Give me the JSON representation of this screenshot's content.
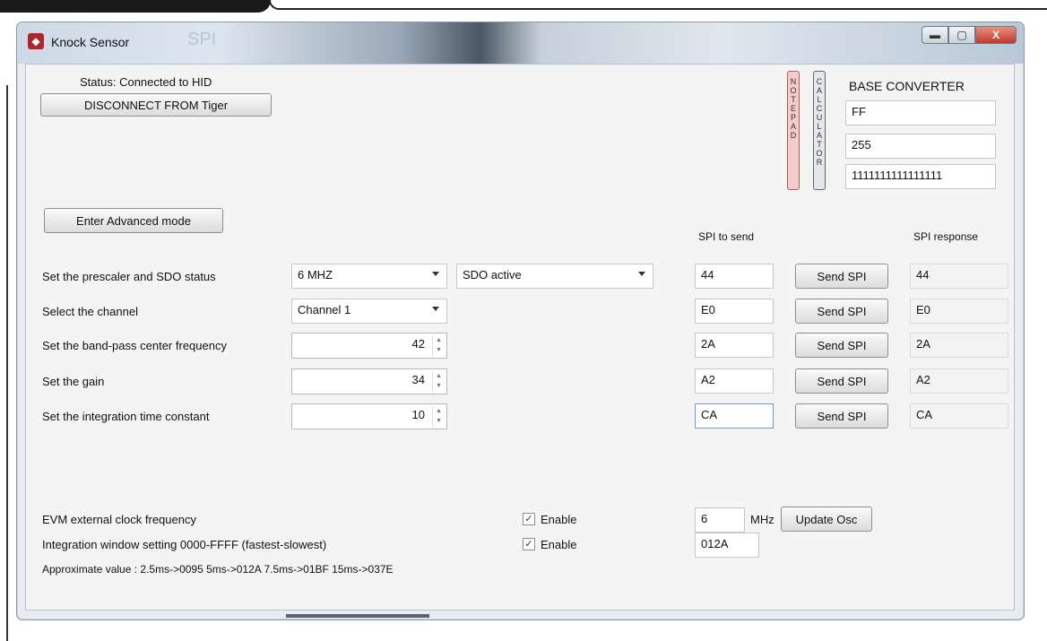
{
  "window": {
    "title": "Knock Sensor",
    "title_ghost": "SPI",
    "controls": {
      "minimize": "▬",
      "maximize": "▢",
      "close": "X"
    }
  },
  "status": {
    "text": "Status: Connected to HID",
    "disconnect_label": "DISCONNECT FROM Tiger"
  },
  "tools": {
    "notepad_label": "NOTEPAD",
    "calculator_label": "CALCULATOR"
  },
  "base_converter": {
    "title": "BASE CONVERTER",
    "hex": "FF",
    "dec": "255",
    "bin": "1111111111111111"
  },
  "advanced_button_label": "Enter Advanced mode",
  "spi": {
    "to_send_header": "SPI to send",
    "response_header": "SPI response",
    "send_label": "Send SPI",
    "rows": [
      {
        "label": "Set the prescaler and SDO status",
        "send": "44",
        "response": "44"
      },
      {
        "label": "Select the channel",
        "send": "E0",
        "response": "E0"
      },
      {
        "label": "Set the band-pass center frequency",
        "send": "2A",
        "response": "2A"
      },
      {
        "label": "Set the gain",
        "send": "A2",
        "response": "A2"
      },
      {
        "label": "Set the integration time constant",
        "send": "CA",
        "response": "CA"
      }
    ]
  },
  "controls": {
    "prescaler": "6 MHZ",
    "sdo": "SDO active",
    "channel": "Channel 1",
    "bandpass": "42",
    "gain": "34",
    "integration_tc": "10"
  },
  "evm": {
    "clock_label": "EVM external clock frequency",
    "clock_enable_label": "Enable",
    "clock_enabled": true,
    "clock_value": "6",
    "clock_unit": "MHz",
    "update_label": "Update Osc",
    "window_label": "Integration window setting 0000-FFFF (fastest-slowest)",
    "window_enable_label": "Enable",
    "window_enabled": true,
    "window_value": "012A",
    "approx_text": "Approximate value : 2.5ms->0095  5ms->012A  7.5ms->01BF  15ms->037E"
  }
}
